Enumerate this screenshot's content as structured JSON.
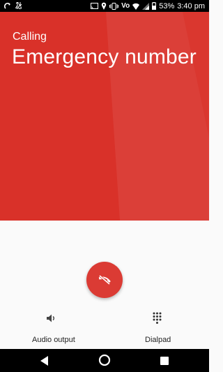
{
  "status_bar": {
    "network_type": "4G",
    "battery_percent": "53%",
    "time": "3:40 pm",
    "volte": "Vo"
  },
  "call": {
    "status": "Calling",
    "callee": "Emergency number"
  },
  "controls": {
    "audio_output_label": "Audio output",
    "dialpad_label": "Dialpad"
  },
  "colors": {
    "header_bg": "#d93129",
    "end_call_bg": "#db3b34"
  }
}
